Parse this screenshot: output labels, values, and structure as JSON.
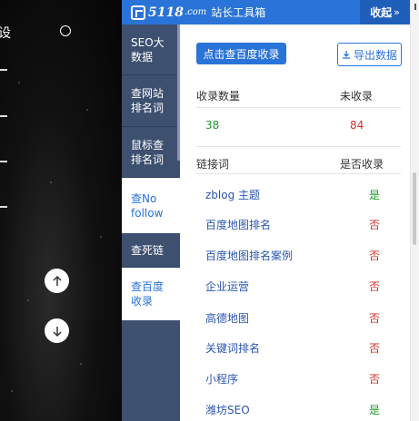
{
  "background_page": {
    "partial_text": "设",
    "icons": [
      "circle-outline-icon",
      "arrow-up-icon",
      "arrow-down-icon"
    ]
  },
  "header": {
    "brand": "5118",
    "brand_suffix": ".com",
    "title": "站长工具箱",
    "collapse_label": "收起",
    "collapse_arrow": "»",
    "accent_color": "#2a73d9"
  },
  "sidebar": {
    "items": [
      {
        "label_line1": "SEO大",
        "label_line2": "数据",
        "active": false
      },
      {
        "label_line1": "查网站",
        "label_line2": "排名词",
        "active": false
      },
      {
        "label_line1": "鼠标查",
        "label_line2": "排名词",
        "active": false
      },
      {
        "label_line1": "查No",
        "label_line2": "follow",
        "active": true
      },
      {
        "label_line1": "查死链",
        "label_line2": "",
        "active": false
      },
      {
        "label_line1": "查百度",
        "label_line2": "收录",
        "active": true
      }
    ]
  },
  "main": {
    "check_button": "点击查百度收录",
    "export_button": "导出数据",
    "stats": {
      "indexed_label": "收录数量",
      "not_indexed_label": "未收录",
      "indexed_value": "38",
      "not_indexed_value": "84"
    },
    "table": {
      "col_link": "链接词",
      "col_status": "是否收录",
      "rows": [
        {
          "keyword": "zblog 主题",
          "status": "是"
        },
        {
          "keyword": "百度地图排名",
          "status": "否"
        },
        {
          "keyword": "百度地图排名案例",
          "status": "否"
        },
        {
          "keyword": "企业运营",
          "status": "否"
        },
        {
          "keyword": "高德地图",
          "status": "否"
        },
        {
          "keyword": "关键词排名",
          "status": "否"
        },
        {
          "keyword": "小程序",
          "status": "否"
        },
        {
          "keyword": "潍坊SEO",
          "status": "是"
        }
      ]
    },
    "colors": {
      "yes": "#1e9a2a",
      "no": "#d0302a"
    }
  }
}
